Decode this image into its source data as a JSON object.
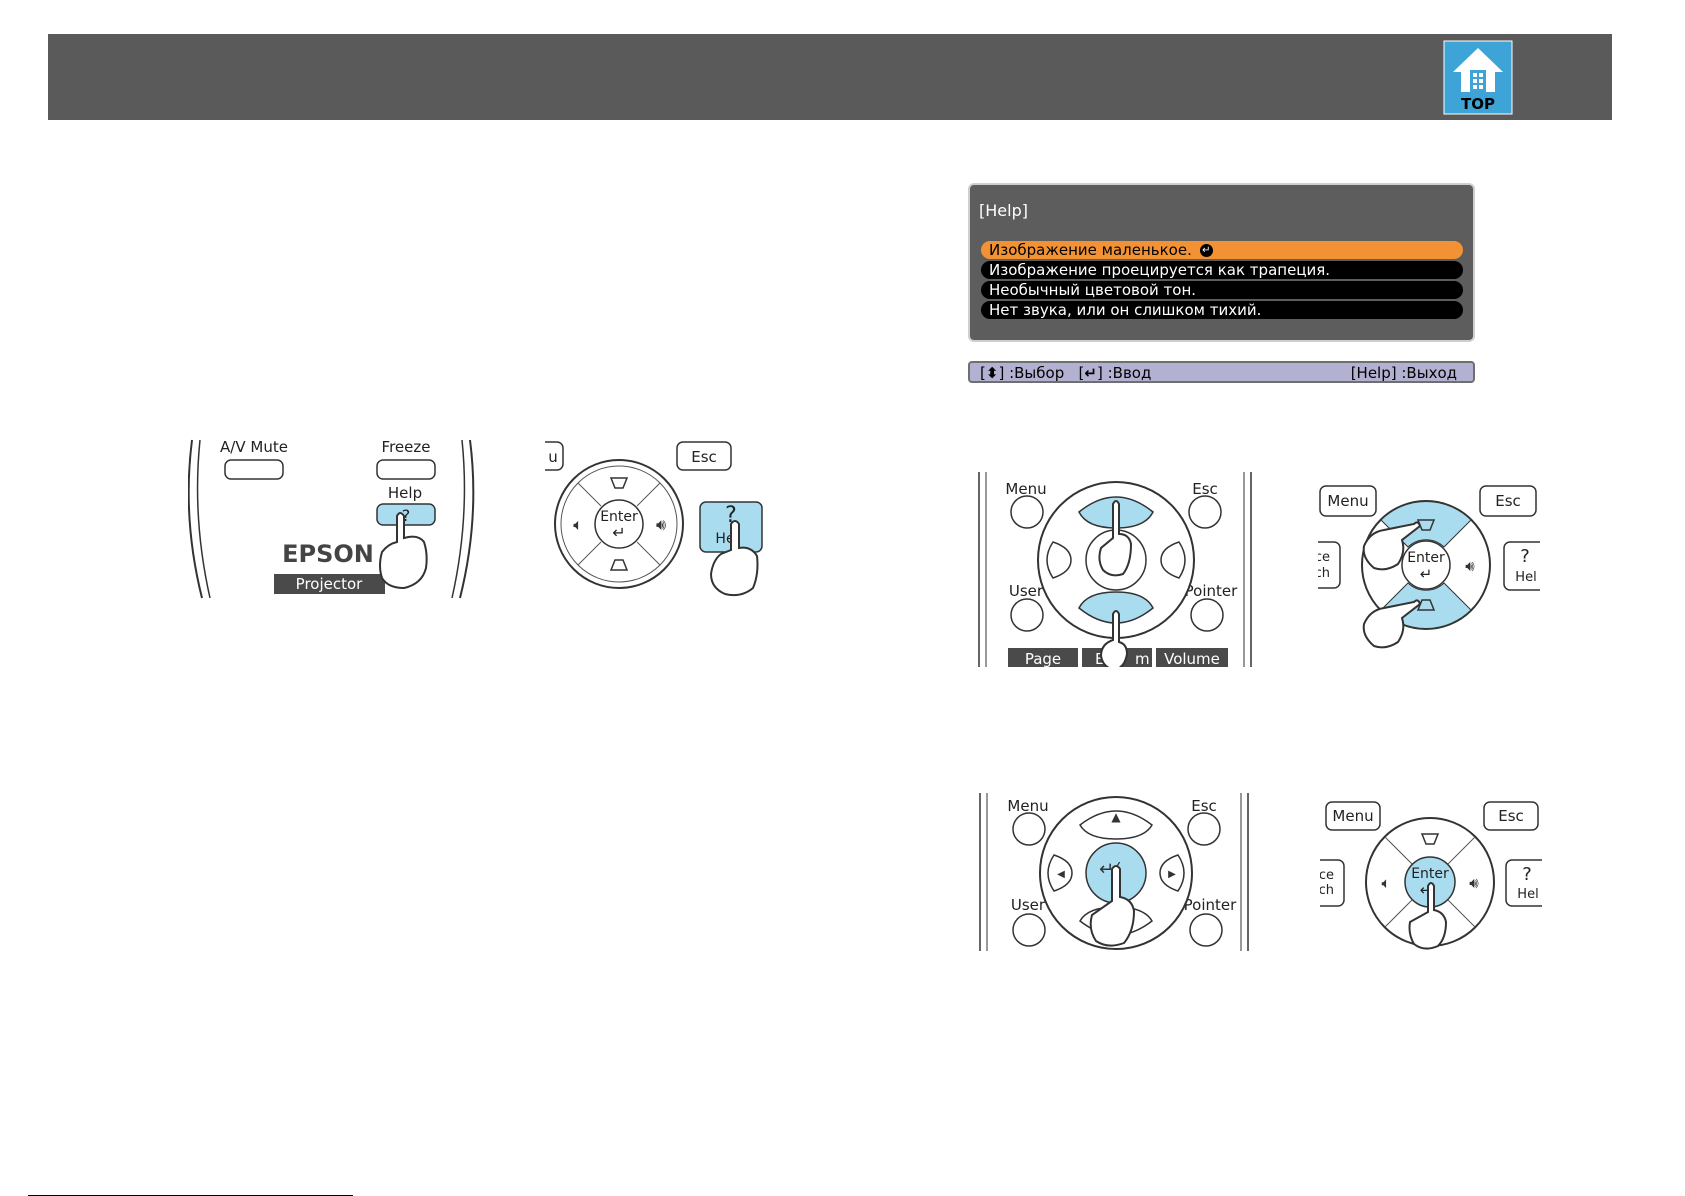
{
  "header": {
    "top_icon_label": "TOP"
  },
  "help_screen": {
    "title": "[Help]",
    "items": [
      {
        "label": "Изображение маленькое.",
        "selected": true
      },
      {
        "label": "Изображение проецируется как трапеция.",
        "selected": false
      },
      {
        "label": "Необычный цветовой тон.",
        "selected": false
      },
      {
        "label": "Нет звука, или он слишком тихий.",
        "selected": false
      }
    ],
    "footer_select": ":Выбор",
    "footer_enter": ":Ввод",
    "footer_exit_key": "[Help]",
    "footer_exit": ":Выход"
  },
  "remote_a": {
    "av_mute": "A/V Mute",
    "freeze": "Freeze",
    "help": "Help",
    "help_glyph": "?",
    "brand": "EPSON",
    "projector": "Projector"
  },
  "control_panel_a": {
    "menu_partial": "u",
    "esc": "Esc",
    "enter": "Enter",
    "help_partial": "He",
    "help_glyph": "?"
  },
  "remote_b": {
    "menu": "Menu",
    "esc": "Esc",
    "user": "User",
    "pointer": "Pointer",
    "page": "Page",
    "ezoom_partial": "E-",
    "ezoom_partial2": "m",
    "volume": "Volume"
  },
  "control_panel_b": {
    "menu": "Menu",
    "esc": "Esc",
    "enter": "Enter",
    "source_partial1": "urce",
    "source_partial2": "arch",
    "help_partial": "Hel",
    "help_glyph": "?"
  },
  "remote_c": {
    "menu": "Menu",
    "esc": "Esc",
    "user": "User",
    "pointer": "Pointer"
  },
  "control_panel_c": {
    "menu": "Menu",
    "esc": "Esc",
    "enter": "Enter",
    "source_partial1": "urce",
    "source_partial2": "arch",
    "help_partial": "Hel",
    "help_glyph": "?"
  },
  "colors": {
    "header": "#5a5a5a",
    "highlight_blue": "#a9dcef",
    "menu_selected": "#f39234",
    "footer_bar": "#b3b1d1",
    "top_icon": "#3ea4d8"
  }
}
